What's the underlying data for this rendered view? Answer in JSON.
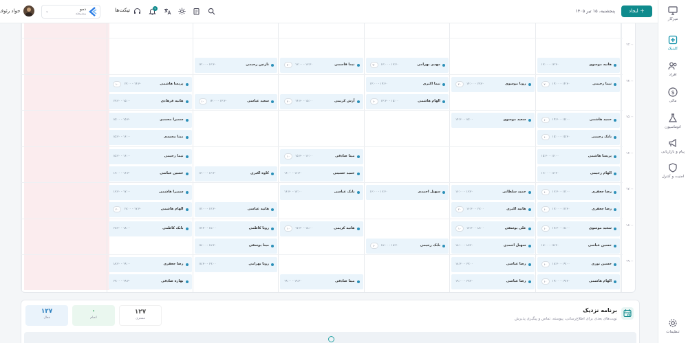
{
  "sidebar": {
    "items": [
      {
        "label": "میزکار",
        "icon": "monitor-icon",
        "active": false
      },
      {
        "label": "کلینیک",
        "icon": "hospital-icon",
        "active": true
      },
      {
        "label": "افراد",
        "icon": "users-icon",
        "active": false
      },
      {
        "label": "مالی",
        "icon": "dollar-icon",
        "active": false
      },
      {
        "label": "اتوماسیون",
        "icon": "flask-icon",
        "active": false
      },
      {
        "label": "پیام و بازاریابی",
        "icon": "megaphone-icon",
        "active": false
      },
      {
        "label": "امنیت و کنترل",
        "icon": "shield-icon",
        "active": false
      }
    ],
    "settings_label": "تنظیمات"
  },
  "header": {
    "create_label": "ایجاد",
    "date": "پنجشنبه، ۱۵ تیر ۱۴۰۵",
    "tickets_label": "تیکت‌ها",
    "notification_count": "۳",
    "tenant_name": "دمو",
    "tenant_sub": "پیشرفته",
    "user_name": "جواد رئوف"
  },
  "calendar": {
    "times": [
      "۱۳:۰۰",
      "۱۴:۰۰",
      "۱۵:۰۰",
      "۱۶:۰۰",
      "۱۷:۰۰",
      "۱۸:۰۰",
      "۱۹:۰۰"
    ],
    "appointments": [
      {
        "col": 0,
        "row": 0,
        "slot": 1,
        "name": "هانیه موسوی",
        "time": "۱۳:۰۰ - ۱۳:۳۰",
        "badge": ""
      },
      {
        "col": 0,
        "row": 1,
        "slot": 0,
        "name": "نیما رحیمی",
        "time": "۱۴:۰۰ - ۱۴:۳۰",
        "badge": "۲۰"
      },
      {
        "col": 0,
        "row": 2,
        "slot": 0,
        "name": "حمید هاشمی",
        "time": "۱۴:۳۰ - ۱۵:۰۰",
        "badge": "۱۰"
      },
      {
        "col": 0,
        "row": 2,
        "slot": 1,
        "name": "بابک رحیمی",
        "time": "۱۵:۰۰ - ۱۵:۳۰",
        "badge": "۱۰"
      },
      {
        "col": 0,
        "row": 3,
        "slot": 0,
        "name": "پریسا هاشمی",
        "time": "۱۵:۳۰ - ۱۶:۰۰",
        "badge": ""
      },
      {
        "col": 0,
        "row": 3,
        "slot": 1,
        "name": "الهام رحیمی",
        "time": "۱۶:۰۰ - ۱۶:۳۰",
        "badge": ""
      },
      {
        "col": 0,
        "row": 4,
        "slot": 0,
        "name": "رضا جعفری",
        "time": "۱۶:۳۰ - ۱۷:۰۰",
        "badge": "۱۰"
      },
      {
        "col": 0,
        "row": 4,
        "slot": 1,
        "name": "رضا جعفری",
        "time": "۱۷:۰۰ - ۱۷:۳۰",
        "badge": "۱۰"
      },
      {
        "col": 0,
        "row": 5,
        "slot": 0,
        "name": "سعید موسوی",
        "time": "۱۷:۳۰ - ۱۸:۰۰",
        "badge": "۱۰"
      },
      {
        "col": 0,
        "row": 5,
        "slot": 1,
        "name": "حسین عباسی",
        "time": "۱۸:۰۰ - ۱۸:۳۰",
        "badge": ""
      },
      {
        "col": 0,
        "row": 6,
        "slot": 0,
        "name": "حسین نوری",
        "time": "۱۸:۳۰ - ۱۹:۰۰",
        "badge": "۱۰"
      },
      {
        "col": 0,
        "row": 6,
        "slot": 1,
        "name": "الهام هاشمی",
        "time": "۱۹:۰۰ - ۱۹:۳۰",
        "badge": "۱۰"
      },
      {
        "col": 1,
        "row": 1,
        "slot": 0,
        "name": "رویا موسوی",
        "time": "۱۴:۰۰ - ۱۴:۳۰",
        "badge": "۲۰"
      },
      {
        "col": 1,
        "row": 2,
        "slot": 0,
        "name": "سعید موسوی",
        "time": "۱۴:۳۰ - ۱۵:۰۰",
        "badge": ""
      },
      {
        "col": 1,
        "row": 4,
        "slot": 0,
        "name": "حمید سلطانی",
        "time": "۱۶:۰۰ - ۱۶:۳۰",
        "badge": ""
      },
      {
        "col": 1,
        "row": 4,
        "slot": 1,
        "name": "هانیه اکبری",
        "time": "۱۶:۳۰ - ۱۷:۰۰",
        "badge": "۲۰"
      },
      {
        "col": 1,
        "row": 5,
        "slot": 0,
        "name": "علی یوسفی",
        "time": "۱۷:۳۰ - ۱۸:۰۰",
        "badge": "۱۰"
      },
      {
        "col": 1,
        "row": 5,
        "slot": 1,
        "name": "سهیل احمدی",
        "time": "۱۸:۰۰ - ۱۸:۳۰",
        "badge": ""
      },
      {
        "col": 1,
        "row": 6,
        "slot": 0,
        "name": "رضا عباسی",
        "time": "۱۸:۳۰ - ۱۹:۰۰",
        "badge": ""
      },
      {
        "col": 1,
        "row": 6,
        "slot": 1,
        "name": "رضا عباسی",
        "time": "۱۹:۰۰ - ۱۹:۳۰",
        "badge": ""
      },
      {
        "col": 2,
        "row": 0,
        "slot": 1,
        "name": "مهدی بهرامی",
        "time": "۱۳:۰۰ - ۱۳:۳۰",
        "badge": "۳۰"
      },
      {
        "col": 2,
        "row": 1,
        "slot": 0,
        "name": "نیما اکبری",
        "time": "۱۴:۰۰ - ۱۴:۳۰",
        "badge": ""
      },
      {
        "col": 2,
        "row": 1,
        "slot": 1,
        "name": "الهام هاشمی",
        "time": "۱۴:۳۰ - ۱۵:۰۰",
        "badge": "۱۰"
      },
      {
        "col": 2,
        "row": 4,
        "slot": 0,
        "name": "سهیل احمدی",
        "time": "۱۶:۰۰ - ۱۶:۳۰",
        "badge": ""
      },
      {
        "col": 2,
        "row": 5,
        "slot": 1,
        "name": "بابک رحیمی",
        "time": "۱۸:۰۰ - ۱۸:۳۰",
        "badge": "۱۰"
      },
      {
        "col": 3,
        "row": 0,
        "slot": 1,
        "name": "نیما قاسمی",
        "time": "۱۳:۰۰ - ۱۳:۳۰",
        "badge": "۲۰"
      },
      {
        "col": 3,
        "row": 1,
        "slot": 1,
        "name": "آرش کریمی",
        "time": "۱۴:۳۰ - ۱۵:۰۰",
        "badge": "۲۰"
      },
      {
        "col": 3,
        "row": 3,
        "slot": 0,
        "name": "مینا صادقی",
        "time": "۱۵:۳۰ - ۱۶:۰۰",
        "badge": "۱۰"
      },
      {
        "col": 3,
        "row": 3,
        "slot": 1,
        "name": "حمید حسینی",
        "time": "۱۶:۰۰ - ۱۶:۳۰",
        "badge": ""
      },
      {
        "col": 3,
        "row": 4,
        "slot": 0,
        "name": "بابک عباسی",
        "time": "۱۶:۳۰ - ۱۷:۰۰",
        "badge": ""
      },
      {
        "col": 3,
        "row": 5,
        "slot": 0,
        "name": "هانیه کریمی",
        "time": "۱۷:۳۰ - ۱۸:۰۰",
        "badge": "۱۰"
      },
      {
        "col": 3,
        "row": 6,
        "slot": 1,
        "name": "مینا صادقی",
        "time": "۱۹:۰۰ - ۱۹:۳۰",
        "badge": ""
      },
      {
        "col": 4,
        "row": 0,
        "slot": 1,
        "name": "نازنین رحیمی",
        "time": "۱۳:۰۰ - ۱۳:۳۰",
        "badge": ""
      },
      {
        "col": 4,
        "row": 1,
        "slot": 1,
        "name": "سعید عباسی",
        "time": "۱۴:۰۰ - ۱۴:۳۰",
        "badge": "۱۰"
      },
      {
        "col": 4,
        "row": 3,
        "slot": 1,
        "name": "کاوه اکبری",
        "time": "۱۶:۰۰ - ۱۶:۳۰",
        "badge": ""
      },
      {
        "col": 4,
        "row": 4,
        "slot": 1,
        "name": "هانیه عباسی",
        "time": "۱۷:۰۰ - ۱۷:۳۰",
        "badge": ""
      },
      {
        "col": 4,
        "row": 5,
        "slot": 0,
        "name": "رویا کاظمی",
        "time": "۱۷:۳۰ - ۱۸:۰۰",
        "badge": ""
      },
      {
        "col": 4,
        "row": 5,
        "slot": 1,
        "name": "مینا یوسفی",
        "time": "۱۸:۰۰ - ۱۸:۳۰",
        "badge": ""
      },
      {
        "col": 4,
        "row": 6,
        "slot": 0,
        "name": "رویا بهرامی",
        "time": "۱۸:۳۰ - ۱۹:۰۰",
        "badge": ""
      },
      {
        "col": 5,
        "row": 1,
        "slot": 0,
        "name": "پریسا هاشمی",
        "time": "۱۴:۰۰ - ۱۴:۳۰",
        "badge": "۱۰"
      },
      {
        "col": 5,
        "row": 1,
        "slot": 1,
        "name": "هانیه فرهادی",
        "time": "۱۴:۳۰ - ۱۵:۰۰",
        "badge": ""
      },
      {
        "col": 5,
        "row": 2,
        "slot": 0,
        "name": "سمیرا محمدی",
        "time": "۱۵:۰۰ - ۱۵:۳۰",
        "badge": ""
      },
      {
        "col": 5,
        "row": 2,
        "slot": 1,
        "name": "مینا محمدی",
        "time": "۱۵:۳۰ - ۱۶:۰۰",
        "badge": ""
      },
      {
        "col": 5,
        "row": 3,
        "slot": 0,
        "name": "نیما رحیمی",
        "time": "۱۵:۳۰ - ۱۶:۰۰",
        "badge": ""
      },
      {
        "col": 5,
        "row": 3,
        "slot": 1,
        "name": "حسین عباسی",
        "time": "۱۶:۰۰ - ۱۶:۳۰",
        "badge": ""
      },
      {
        "col": 5,
        "row": 4,
        "slot": 0,
        "name": "سمیرا هاشمی",
        "time": "۱۶:۳۰ - ۱۷:۰۰",
        "badge": ""
      },
      {
        "col": 5,
        "row": 4,
        "slot": 1,
        "name": "الهام هاشمی",
        "time": "۱۷:۰۰ - ۱۷:۳۰",
        "badge": "۲۰"
      },
      {
        "col": 5,
        "row": 5,
        "slot": 0,
        "name": "بابک کاظمی",
        "time": "۱۷:۳۰ - ۱۸:۰۰",
        "badge": ""
      },
      {
        "col": 5,
        "row": 6,
        "slot": 0,
        "name": "رضا جعفری",
        "time": "۱۸:۳۰ - ۱۹:۰۰",
        "badge": ""
      },
      {
        "col": 5,
        "row": 6,
        "slot": 1,
        "name": "بهاره صادقی",
        "time": "۱۹:۰۰ - ۱۹:۳۰",
        "badge": ""
      }
    ]
  },
  "nearby": {
    "title": "برنامه نزدیک",
    "subtitle": "نوبت‌های بعدی برای اطلاع‌رسانی، پیوسته، تماس و پیگیری پذیرش",
    "stats": [
      {
        "value": "۱۲۷",
        "label": "مشتری"
      },
      {
        "value": "۰",
        "label": "انجام"
      },
      {
        "value": "۱۲۷",
        "label": "فعال"
      }
    ]
  },
  "colors": {
    "accent": "#0f8b8d",
    "appt_bg": "#eaf4fb",
    "blocked_bg": "#fbecee"
  }
}
